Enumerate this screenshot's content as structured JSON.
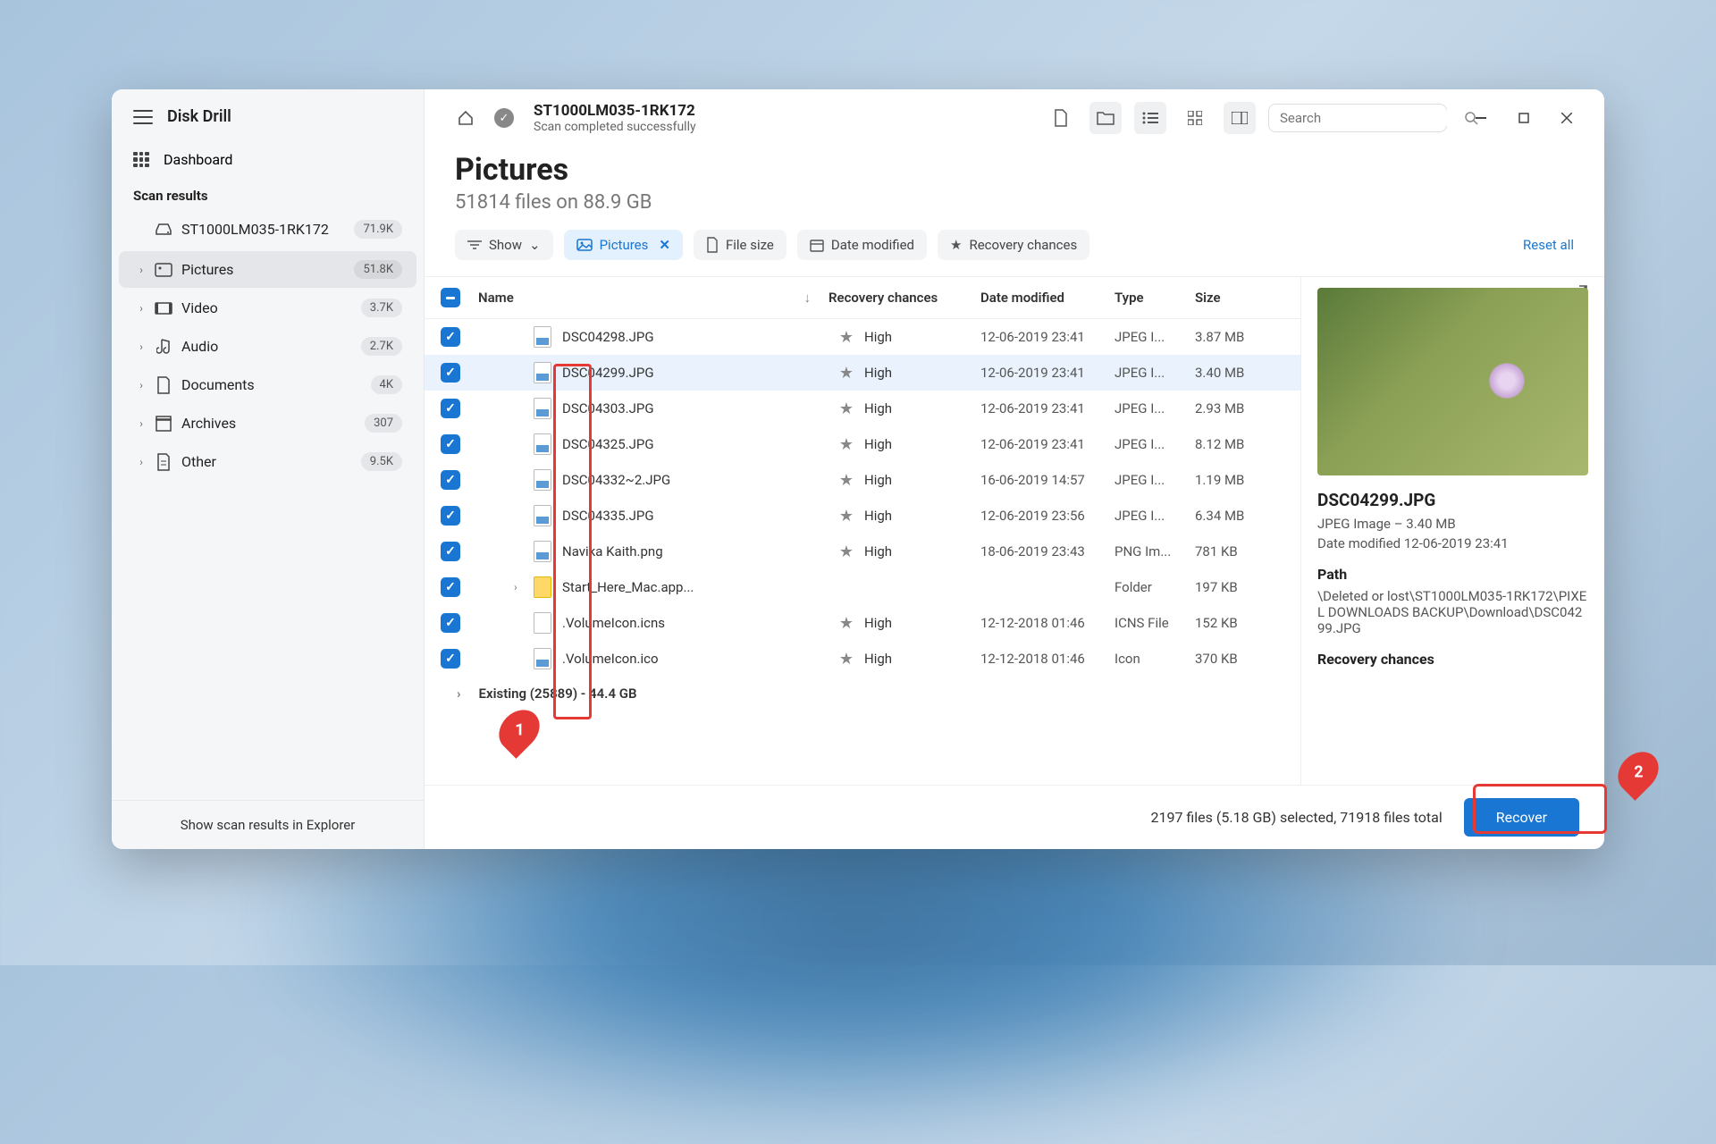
{
  "app": {
    "title": "Disk Drill",
    "dashboard": "Dashboard",
    "scan_results_label": "Scan results"
  },
  "drive": {
    "name": "ST1000LM035-1RK172",
    "status": "Scan completed successfully",
    "badge": "71.9K"
  },
  "sidebar_items": [
    {
      "label": "Pictures",
      "badge": "51.8K",
      "icon": "image"
    },
    {
      "label": "Video",
      "badge": "3.7K",
      "icon": "video"
    },
    {
      "label": "Audio",
      "badge": "2.7K",
      "icon": "audio"
    },
    {
      "label": "Documents",
      "badge": "4K",
      "icon": "doc"
    },
    {
      "label": "Archives",
      "badge": "307",
      "icon": "archive"
    },
    {
      "label": "Other",
      "badge": "9.5K",
      "icon": "other"
    }
  ],
  "sidebar_footer": "Show scan results in Explorer",
  "header": {
    "title": "Pictures",
    "subtitle": "51814 files on 88.9 GB"
  },
  "filters": {
    "show": "Show",
    "pictures": "Pictures",
    "filesize": "File size",
    "datemod": "Date modified",
    "recovery": "Recovery chances",
    "reset": "Reset all"
  },
  "columns": {
    "name": "Name",
    "recovery": "Recovery chances",
    "date": "Date modified",
    "type": "Type",
    "size": "Size"
  },
  "rows": [
    {
      "name": "DSC04298.JPG",
      "rec": "High",
      "date": "12-06-2019 23:41",
      "type": "JPEG I...",
      "size": "3.87 MB",
      "icon": "img"
    },
    {
      "name": "DSC04299.JPG",
      "rec": "High",
      "date": "12-06-2019 23:41",
      "type": "JPEG I...",
      "size": "3.40 MB",
      "icon": "img",
      "selected": true
    },
    {
      "name": "DSC04303.JPG",
      "rec": "High",
      "date": "12-06-2019 23:41",
      "type": "JPEG I...",
      "size": "2.93 MB",
      "icon": "img"
    },
    {
      "name": "DSC04325.JPG",
      "rec": "High",
      "date": "12-06-2019 23:41",
      "type": "JPEG I...",
      "size": "8.12 MB",
      "icon": "img"
    },
    {
      "name": "DSC04332~2.JPG",
      "rec": "High",
      "date": "16-06-2019 14:57",
      "type": "JPEG I...",
      "size": "1.19 MB",
      "icon": "img"
    },
    {
      "name": "DSC04335.JPG",
      "rec": "High",
      "date": "12-06-2019 23:56",
      "type": "JPEG I...",
      "size": "6.34 MB",
      "icon": "img"
    },
    {
      "name": "Navika Kaith.png",
      "rec": "High",
      "date": "18-06-2019 23:43",
      "type": "PNG Im...",
      "size": "781 KB",
      "icon": "img"
    },
    {
      "name": "Start_Here_Mac.app...",
      "rec": "",
      "date": "",
      "type": "Folder",
      "size": "197 KB",
      "icon": "folder",
      "expandable": true
    },
    {
      "name": ".VolumeIcon.icns",
      "rec": "High",
      "date": "12-12-2018 01:46",
      "type": "ICNS File",
      "size": "152 KB",
      "icon": "generic"
    },
    {
      "name": ".VolumeIcon.ico",
      "rec": "High",
      "date": "12-12-2018 01:46",
      "type": "Icon",
      "size": "370 KB",
      "icon": "img"
    }
  ],
  "summary": "Existing (25889) - 44.4 GB",
  "preview": {
    "title": "DSC04299.JPG",
    "meta": "JPEG Image – 3.40 MB",
    "modified": "Date modified 12-06-2019 23:41",
    "path_label": "Path",
    "path": "\\Deleted or lost\\ST1000LM035-1RK172\\PIXEL DOWNLOADS BACKUP\\Download\\DSC04299.JPG",
    "recovery_label": "Recovery chances"
  },
  "bottom": {
    "status": "2197 files (5.18 GB) selected, 71918 files total",
    "recover": "Recover"
  },
  "search": {
    "placeholder": "Search"
  },
  "annotations": {
    "1": "1",
    "2": "2"
  }
}
